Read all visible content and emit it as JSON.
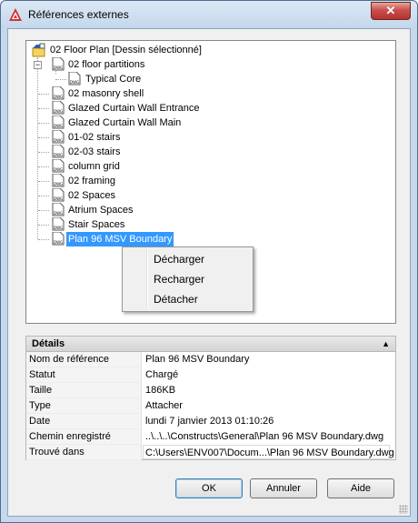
{
  "window": {
    "title": "Références externes",
    "close_label": "✕"
  },
  "tree": {
    "root": {
      "label": "02 Floor Plan [Dessin sélectionné]"
    },
    "items": [
      {
        "label": "02 floor partitions",
        "expanded": true
      },
      {
        "label": "Typical Core",
        "child": true
      },
      {
        "label": "02 masonry shell"
      },
      {
        "label": "Glazed Curtain Wall Entrance"
      },
      {
        "label": "Glazed Curtain Wall Main"
      },
      {
        "label": "01-02 stairs"
      },
      {
        "label": "02-03 stairs"
      },
      {
        "label": "column grid"
      },
      {
        "label": "02 framing"
      },
      {
        "label": "02 Spaces"
      },
      {
        "label": "Atrium Spaces"
      },
      {
        "label": "Stair Spaces"
      },
      {
        "label": "Plan 96 MSV Boundary",
        "selected": true
      }
    ],
    "icon_text": "DWG"
  },
  "context_menu": {
    "items": [
      "Décharger",
      "Recharger",
      "Détacher"
    ]
  },
  "details": {
    "title": "Détails",
    "collapse_icon": "▲",
    "rows": [
      {
        "key": "Nom de référence",
        "value": "Plan 96 MSV Boundary"
      },
      {
        "key": "Statut",
        "value": "Chargé"
      },
      {
        "key": "Taille",
        "value": "186KB"
      },
      {
        "key": "Type",
        "value": "Attacher"
      },
      {
        "key": "Date",
        "value": "lundi 7 janvier 2013  01:10:26"
      },
      {
        "key": "Chemin enregistré",
        "value": "..\\..\\..\\Constructs\\General\\Plan 96 MSV Boundary.dwg"
      },
      {
        "key": "Trouvé dans",
        "value": "C:\\Users\\ENV007\\Docum...\\Plan 96 MSV Boundary.dwg"
      }
    ]
  },
  "buttons": {
    "ok": "OK",
    "cancel": "Annuler",
    "help": "Aide"
  },
  "colors": {
    "selection": "#3399ff",
    "accent": "#c75050"
  }
}
